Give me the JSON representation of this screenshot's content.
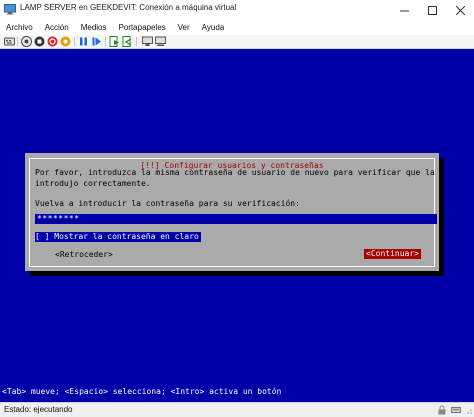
{
  "window": {
    "title": "LAMP SERVER en GEEKDEVIT: Conexión a máquina virtual"
  },
  "menu": {
    "items": [
      "Archivo",
      "Acción",
      "Medios",
      "Portapapeles",
      "Ver",
      "Ayuda"
    ]
  },
  "dialog": {
    "title": "[!!] Configurar usuarios y contraseñas",
    "message_line1": "Por favor, introduzca la misma contraseña de usuario de nuevo para verificar que la",
    "message_line2": "introdujo correctamente.",
    "prompt": "Vuelva a introducir la contraseña para su verificación:",
    "password_value": "********",
    "show_password_label": "[ ] Mostrar la contraseña en claro",
    "back_label": "<Retroceder>",
    "continue_label": "<Continuar>"
  },
  "console": {
    "hint": "<Tab> mueve; <Espacio> selecciona; <Intro> activa un botón"
  },
  "status": {
    "text": "Estado: ejecutando"
  },
  "colors": {
    "console_bg": "#0000a8",
    "dialog_bg": "#aaaaaa",
    "accent_red": "#a80000"
  }
}
